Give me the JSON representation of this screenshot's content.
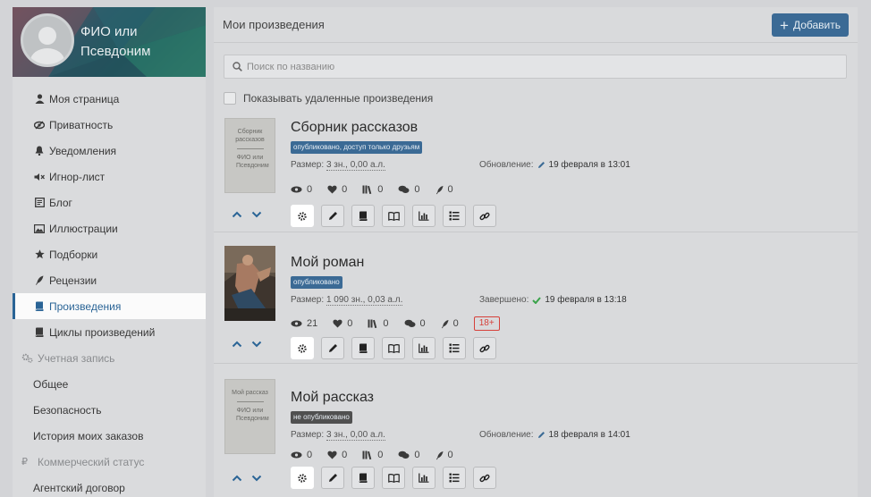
{
  "profile": {
    "name": "ФИО или Псевдоним"
  },
  "sidebar": {
    "items": [
      {
        "label": "Моя страница",
        "icon": "user-icon"
      },
      {
        "label": "Приватность",
        "icon": "eye-slash-icon"
      },
      {
        "label": "Уведомления",
        "icon": "bell-icon"
      },
      {
        "label": "Игнор-лист",
        "icon": "mute-icon"
      },
      {
        "label": "Блог",
        "icon": "blog-icon"
      },
      {
        "label": "Иллюстрации",
        "icon": "image-icon"
      },
      {
        "label": "Подборки",
        "icon": "star-icon"
      },
      {
        "label": "Рецензии",
        "icon": "quill-icon"
      },
      {
        "label": "Произведения",
        "icon": "book-icon"
      },
      {
        "label": "Циклы произведений",
        "icon": "books-icon"
      }
    ],
    "account_section": "Учетная запись",
    "account_items": [
      "Общее",
      "Безопасность",
      "История моих заказов"
    ],
    "commercial_section": "Коммерческий статус",
    "commercial_items": [
      "Агентский договор"
    ]
  },
  "main": {
    "title": "Мои произведения",
    "add_label": "Добавить",
    "search_placeholder": "Поиск по названию",
    "show_deleted_label": "Показывать удаленные произведения"
  },
  "works": [
    {
      "title": "Сборник рассказов",
      "status": "опубликовано, доступ только друзьям",
      "status_color": "#3b6a95",
      "size_label": "Размер:",
      "size_value": "3 зн., 0,00 а.л.",
      "date_label": "Обновление:",
      "date_value": "19 февраля в 13:01",
      "cover_title": "Сборник рассказов",
      "cover_author": "ФИО или Псевдоним",
      "stats": {
        "views": "0",
        "likes": "0",
        "library": "0",
        "comments": "0",
        "reviews": "0"
      }
    },
    {
      "title": "Мой роман",
      "status": "опубликовано",
      "status_color": "#3b6a95",
      "size_label": "Размер:",
      "size_value": "1 090 зн., 0,03 а.л.",
      "date_label": "Завершено:",
      "date_value": "19 февраля в 13:18",
      "stats": {
        "views": "21",
        "likes": "0",
        "library": "0",
        "comments": "0",
        "reviews": "0"
      },
      "age_rating": "18+"
    },
    {
      "title": "Мой рассказ",
      "status": "не опубликовано",
      "status_color": "#505050",
      "size_label": "Размер:",
      "size_value": "3 зн., 0,00 а.л.",
      "date_label": "Обновление:",
      "date_value": "18 февраля в 14:01",
      "cover_title": "Мой рассказ",
      "cover_author": "ФИО или Псевдоним",
      "stats": {
        "views": "0",
        "likes": "0",
        "library": "0",
        "comments": "0",
        "reviews": "0"
      }
    }
  ],
  "colors": {
    "accent": "#3b6a95",
    "active_nav": "#2a6496",
    "adult": "#d6403a",
    "check": "#3aa34a"
  }
}
